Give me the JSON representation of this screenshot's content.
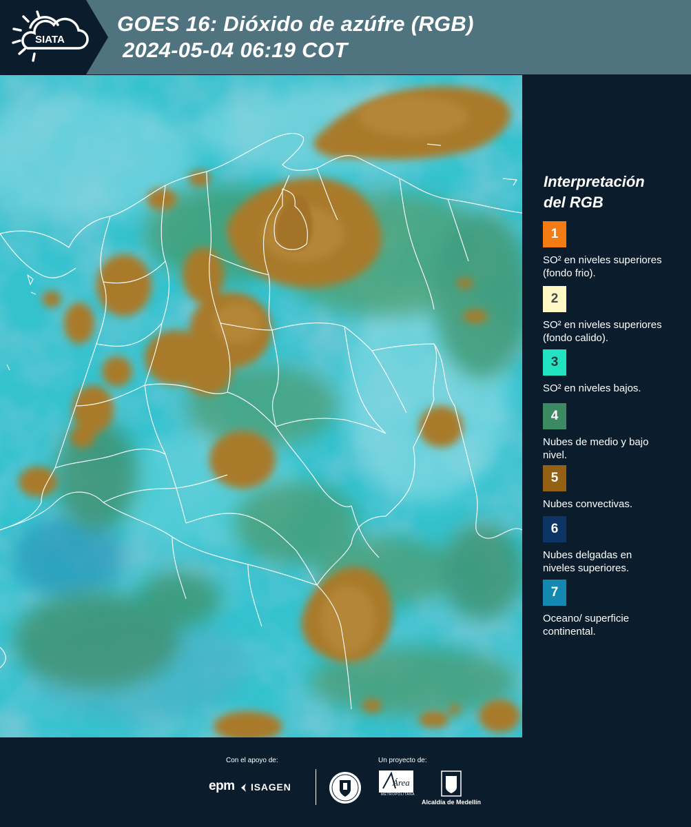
{
  "header": {
    "logo_text": "SIATA",
    "title_line1": "GOES 16: Dióxido de azúfre (RGB)",
    "title_line2": "2024-05-04 06:19 COT"
  },
  "legend": {
    "title_line1": "Interpretación",
    "title_line2": "del RGB",
    "items": [
      {
        "num": "1",
        "color": "#f47c12",
        "num_color": "#ffffff",
        "text": "SO² en niveles superiores (fondo frio)."
      },
      {
        "num": "2",
        "color": "#fff7c4",
        "num_color": "#4a4a4a",
        "text": "SO² en niveles superiores (fondo calido)."
      },
      {
        "num": "3",
        "color": "#22e3c1",
        "num_color": "#1a3a3a",
        "text": "SO² en niveles bajos."
      },
      {
        "num": "4",
        "color": "#3b8a62",
        "num_color": "#ffffff",
        "text": "Nubes de medio y bajo nivel."
      },
      {
        "num": "5",
        "color": "#936014",
        "num_color": "#ffffff",
        "text": "Nubes convectivas."
      },
      {
        "num": "6",
        "color": "#0c3566",
        "num_color": "#ffffff",
        "text": "Nubes delgadas en niveles superiores."
      },
      {
        "num": "7",
        "color": "#1388b0",
        "num_color": "#ffffff",
        "text": "Oceano/ superficie continental."
      }
    ]
  },
  "footer": {
    "support_label": "Con el apoyo de:",
    "project_label": "Un proyecto de:",
    "epm": "epm",
    "isagen": "ISAGEN",
    "area_name": "Área",
    "area_sub": "METROPOLITANA",
    "alcaldia": "Alcaldía de Medellín"
  },
  "map": {
    "background_color": "#35c2cf",
    "cloud_color": "#a87a2a",
    "border_color": "#ffffff"
  }
}
